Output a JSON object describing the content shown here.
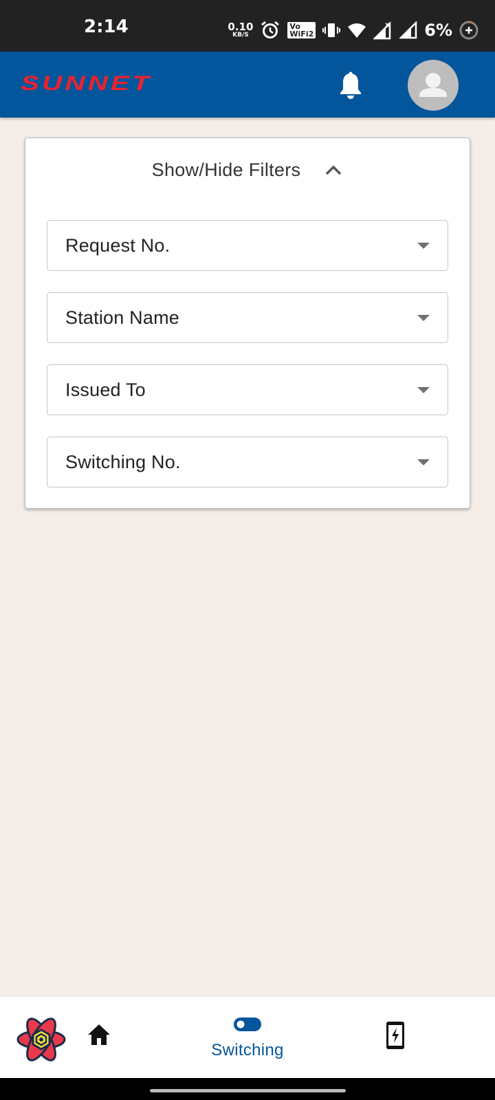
{
  "status_bar": {
    "time": "2:14",
    "net_speed_value": "0.10",
    "net_speed_unit": "KB/S",
    "vowifi_line1": "Vo",
    "vowifi_line2": "WiFi2",
    "battery_percent": "6%"
  },
  "app_bar": {
    "logo_text": "SUNNET",
    "notification_icon": "bell-icon",
    "avatar_icon": "user-avatar-icon"
  },
  "filters": {
    "toggle_label": "Show/Hide Filters",
    "expanded": true,
    "dropdowns": [
      {
        "label": "Request No."
      },
      {
        "label": "Station Name"
      },
      {
        "label": "Issued To"
      },
      {
        "label": "Switching No."
      }
    ]
  },
  "bottom_nav": {
    "items": [
      {
        "icon": "react-logo-icon"
      },
      {
        "icon": "home-icon"
      },
      {
        "icon": "toggle-switch-icon",
        "label": "Switching",
        "active": true
      },
      {
        "icon": "mobile-power-icon"
      }
    ]
  },
  "colors": {
    "primary": "#03559c",
    "brand_red": "#e8232f",
    "background": "#f4ede8"
  }
}
